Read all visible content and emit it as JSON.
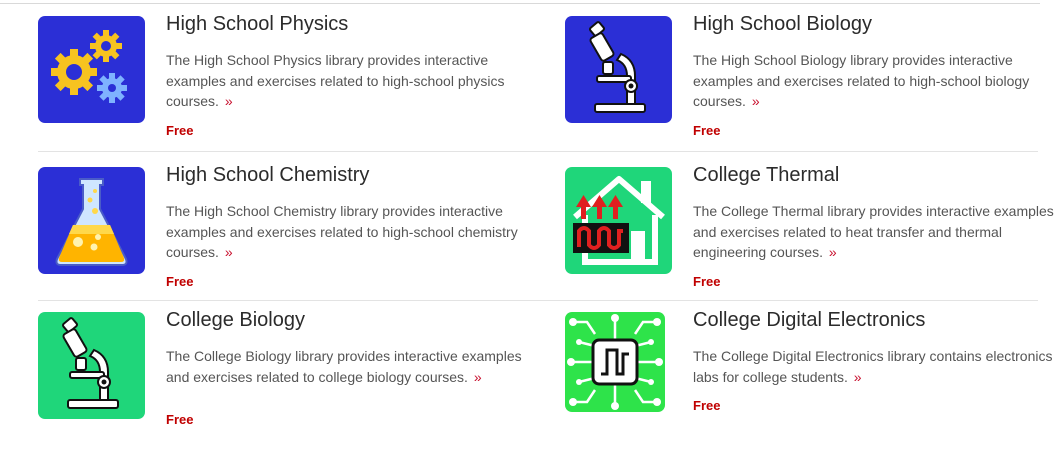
{
  "courses": [
    {
      "title": "High School Physics",
      "description": "The High School Physics library provides interactive examples and exercises related to high-school physics courses.",
      "more": "»",
      "price": "Free",
      "icon": "gears-icon"
    },
    {
      "title": "High School Biology",
      "description": "The High School Biology library provides interactive examples and exercises related to high-school biology courses.",
      "more": "»",
      "price": "Free",
      "icon": "microscope-icon"
    },
    {
      "title": "High School Chemistry",
      "description": "The High School Chemistry library provides interactive examples and exercises related to high-school chemistry courses.",
      "more": "»",
      "price": "Free",
      "icon": "flask-icon"
    },
    {
      "title": "College Thermal",
      "description": "The College Thermal library provides interactive examples and exercises related to heat transfer and thermal engineering courses.",
      "more": "»",
      "price": "Free",
      "icon": "heated-house-icon"
    },
    {
      "title": "College Biology",
      "description": "The College Biology library provides interactive examples and exercises related to college biology courses.",
      "more": "»",
      "price": "Free",
      "icon": "microscope-icon"
    },
    {
      "title": "College Digital Electronics",
      "description": "The College Digital Electronics library contains electronics labs for college students.",
      "more": "»",
      "price": "Free",
      "icon": "circuit-chip-icon"
    }
  ],
  "colors": {
    "title": "#2b2b2b",
    "description": "#555555",
    "price": "#c00000",
    "more_link": "#c8102e",
    "icon_blue": "#2b2fd6",
    "icon_green": "#1fd67a"
  }
}
